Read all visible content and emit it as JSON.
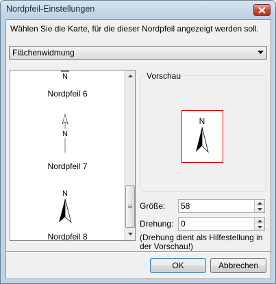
{
  "window": {
    "title": "Nordpfeil-Einstellungen"
  },
  "dialog": {
    "instruction": "Wählen Sie die Karte, für die dieser Nordpfeil angezeigt werden soll.",
    "map_select": {
      "value": "Flächenwidmung"
    }
  },
  "arrow_list": {
    "items": [
      {
        "label": "Nordpfeil 6",
        "glyph": "N",
        "style": "partial"
      },
      {
        "label": "Nordpfeil 7",
        "glyph": "N",
        "style": "thin-line-arrow"
      },
      {
        "label": "Nordpfeil 8",
        "glyph": "N",
        "style": "split-half-filled"
      }
    ],
    "selected_index": 2
  },
  "preview": {
    "legend": "Vorschau",
    "glyph": "N",
    "frame_color": "#d40000"
  },
  "size": {
    "label": "Größe:",
    "value": "58"
  },
  "rotation": {
    "label": "Drehung:",
    "value": "0"
  },
  "hint": "(Drehung dient als Hilfestellung in der Vorschau!)",
  "buttons": {
    "ok": "OK",
    "cancel": "Abbrechen"
  },
  "colors": {
    "titlebar": "#bfd3e6",
    "close_button": "#c9452a",
    "dialog_bg": "#f0f0f0"
  }
}
